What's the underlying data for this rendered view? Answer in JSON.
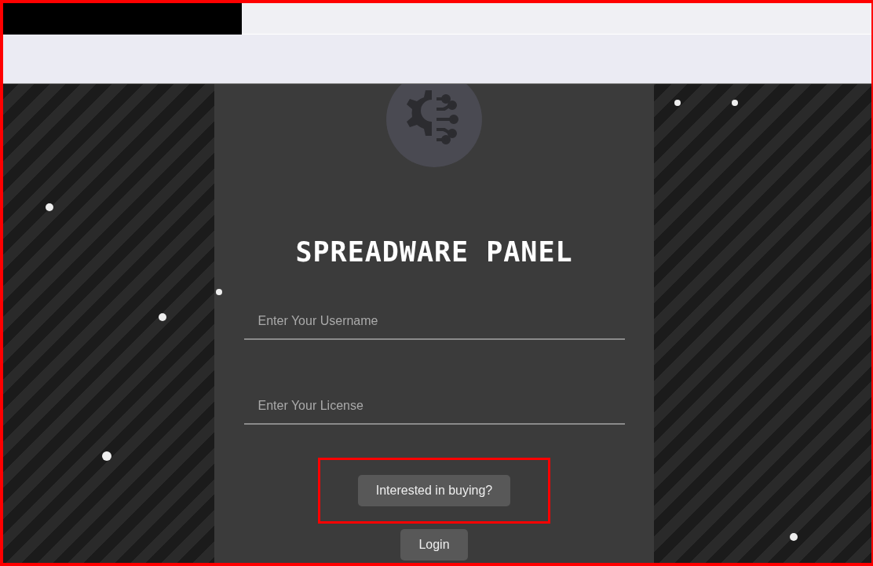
{
  "panel": {
    "title": "SPREADWARE PANEL"
  },
  "fields": [
    {
      "placeholder": "Enter Your Username"
    },
    {
      "placeholder": "Enter Your License"
    }
  ],
  "buttons": [
    {
      "label": "Interested in buying?",
      "highlighted": true
    },
    {
      "label": "Login",
      "highlighted": false
    }
  ]
}
